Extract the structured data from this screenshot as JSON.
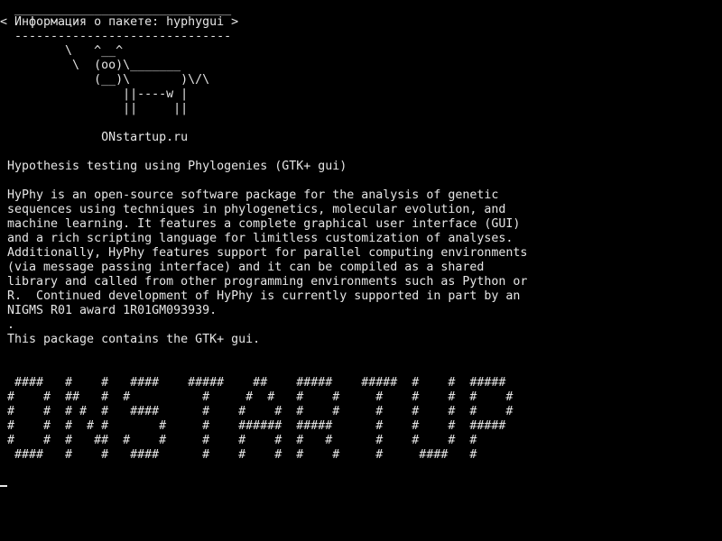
{
  "terminal": {
    "background": "#000000",
    "foreground": "#e6e6e6",
    "cowsay": {
      "border_top": " ______________________________",
      "message": "< Информация о пакете: hyphygui >",
      "border_bottom": " ------------------------------",
      "cow": [
        "        \\   ^__^",
        "         \\  (oo)\\_______",
        "            (__)\\       )\\/\\",
        "                ||----w |",
        "                ||     ||"
      ]
    },
    "site": "             ONstartup.ru",
    "summary": "Hypothesis testing using Phylogenies (GTK+ gui)",
    "description": [
      "HyPhy is an open-source software package for the analysis of genetic",
      "sequences using techniques in phylogenetics, molecular evolution, and",
      "machine learning. It features a complete graphical user interface (GUI)",
      "and a rich scripting language for limitless customization of analyses.",
      "Additionally, HyPhy features support for parallel computing environments",
      "(via message passing interface) and it can be compiled as a shared",
      "library and called from other programming environments such as Python or",
      "R.  Continued development of HyPhy is currently supported in part by an",
      "NIGMS R01 award 1R01GM093939.",
      ".",
      "This package contains the GTK+ gui."
    ],
    "banner": [
      " ####   #    #   ####    #####    ##    #####    #####  #    #  #####",
      "#    #  ##   #  #          #     #  #   #    #     #    #    #  #    #",
      "#    #  # #  #   ####      #    #    #  #    #     #    #    #  #    #",
      "#    #  #  # #       #     #    ######  #####      #    #    #  #####",
      "#    #  #   ##  #    #     #    #    #  #   #      #    #    #  #",
      " ####   #    #   ####      #    #    #  #    #     #     ####   #"
    ]
  }
}
